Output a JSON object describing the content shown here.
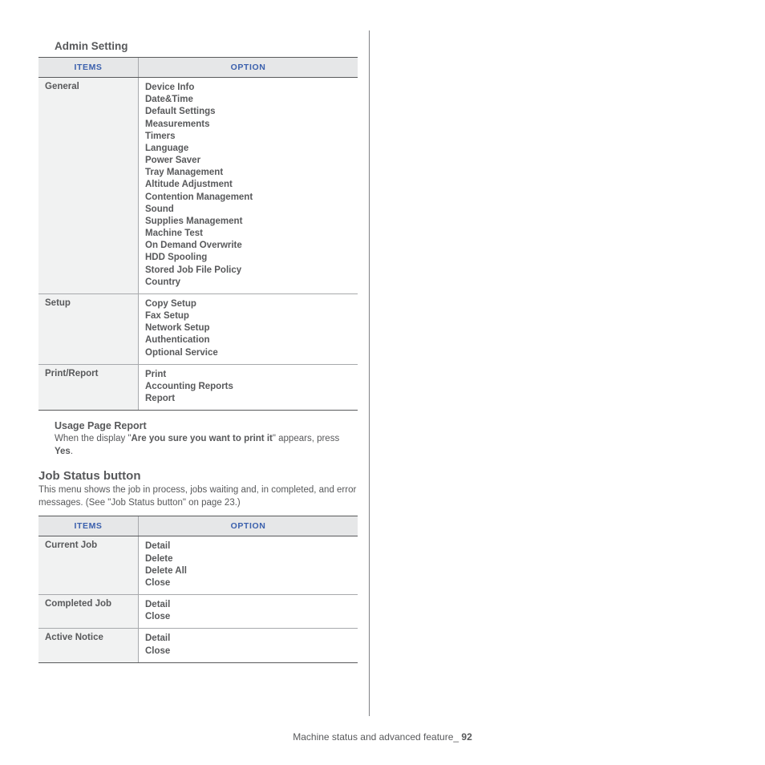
{
  "admin": {
    "heading": "Admin Setting",
    "headers": {
      "items": "Items",
      "option": "Option"
    },
    "rows": [
      {
        "item": "General",
        "options": [
          "Device Info",
          "Date&Time",
          "Default Settings",
          "Measurements",
          "Timers",
          "Language",
          "Power Saver",
          "Tray Management",
          "Altitude Adjustment",
          "Contention Management",
          "Sound",
          "Supplies Management",
          "Machine Test",
          "On Demand Overwrite",
          "HDD Spooling",
          "Stored Job File Policy",
          "Country"
        ]
      },
      {
        "item": "Setup",
        "options": [
          "Copy Setup",
          "Fax Setup",
          "Network Setup",
          "Authentication",
          "Optional Service"
        ]
      },
      {
        "item": "Print/Report",
        "options": [
          "Print",
          "Accounting Reports",
          "Report"
        ]
      }
    ]
  },
  "usage": {
    "heading": "Usage Page Report",
    "text_a": "When the display \"",
    "text_b": "Are you sure you want to print it",
    "text_c": "\" appears, press ",
    "text_d": "Yes",
    "text_e": "."
  },
  "jobstatus": {
    "heading": "Job Status button",
    "desc": "This menu shows the job in process, jobs waiting and, in completed, and error messages. (See \"Job Status button\" on page 23.)",
    "headers": {
      "items": "Items",
      "option": "Option"
    },
    "rows": [
      {
        "item": "Current Job",
        "options": [
          "Detail",
          "Delete",
          "Delete All",
          "Close"
        ]
      },
      {
        "item": "Completed Job",
        "options": [
          "Detail",
          "Close"
        ]
      },
      {
        "item": "Active Notice",
        "options": [
          "Detail",
          "Close"
        ]
      }
    ]
  },
  "footer": {
    "text": "Machine status and advanced feature",
    "sep": "_ ",
    "page": "92"
  }
}
